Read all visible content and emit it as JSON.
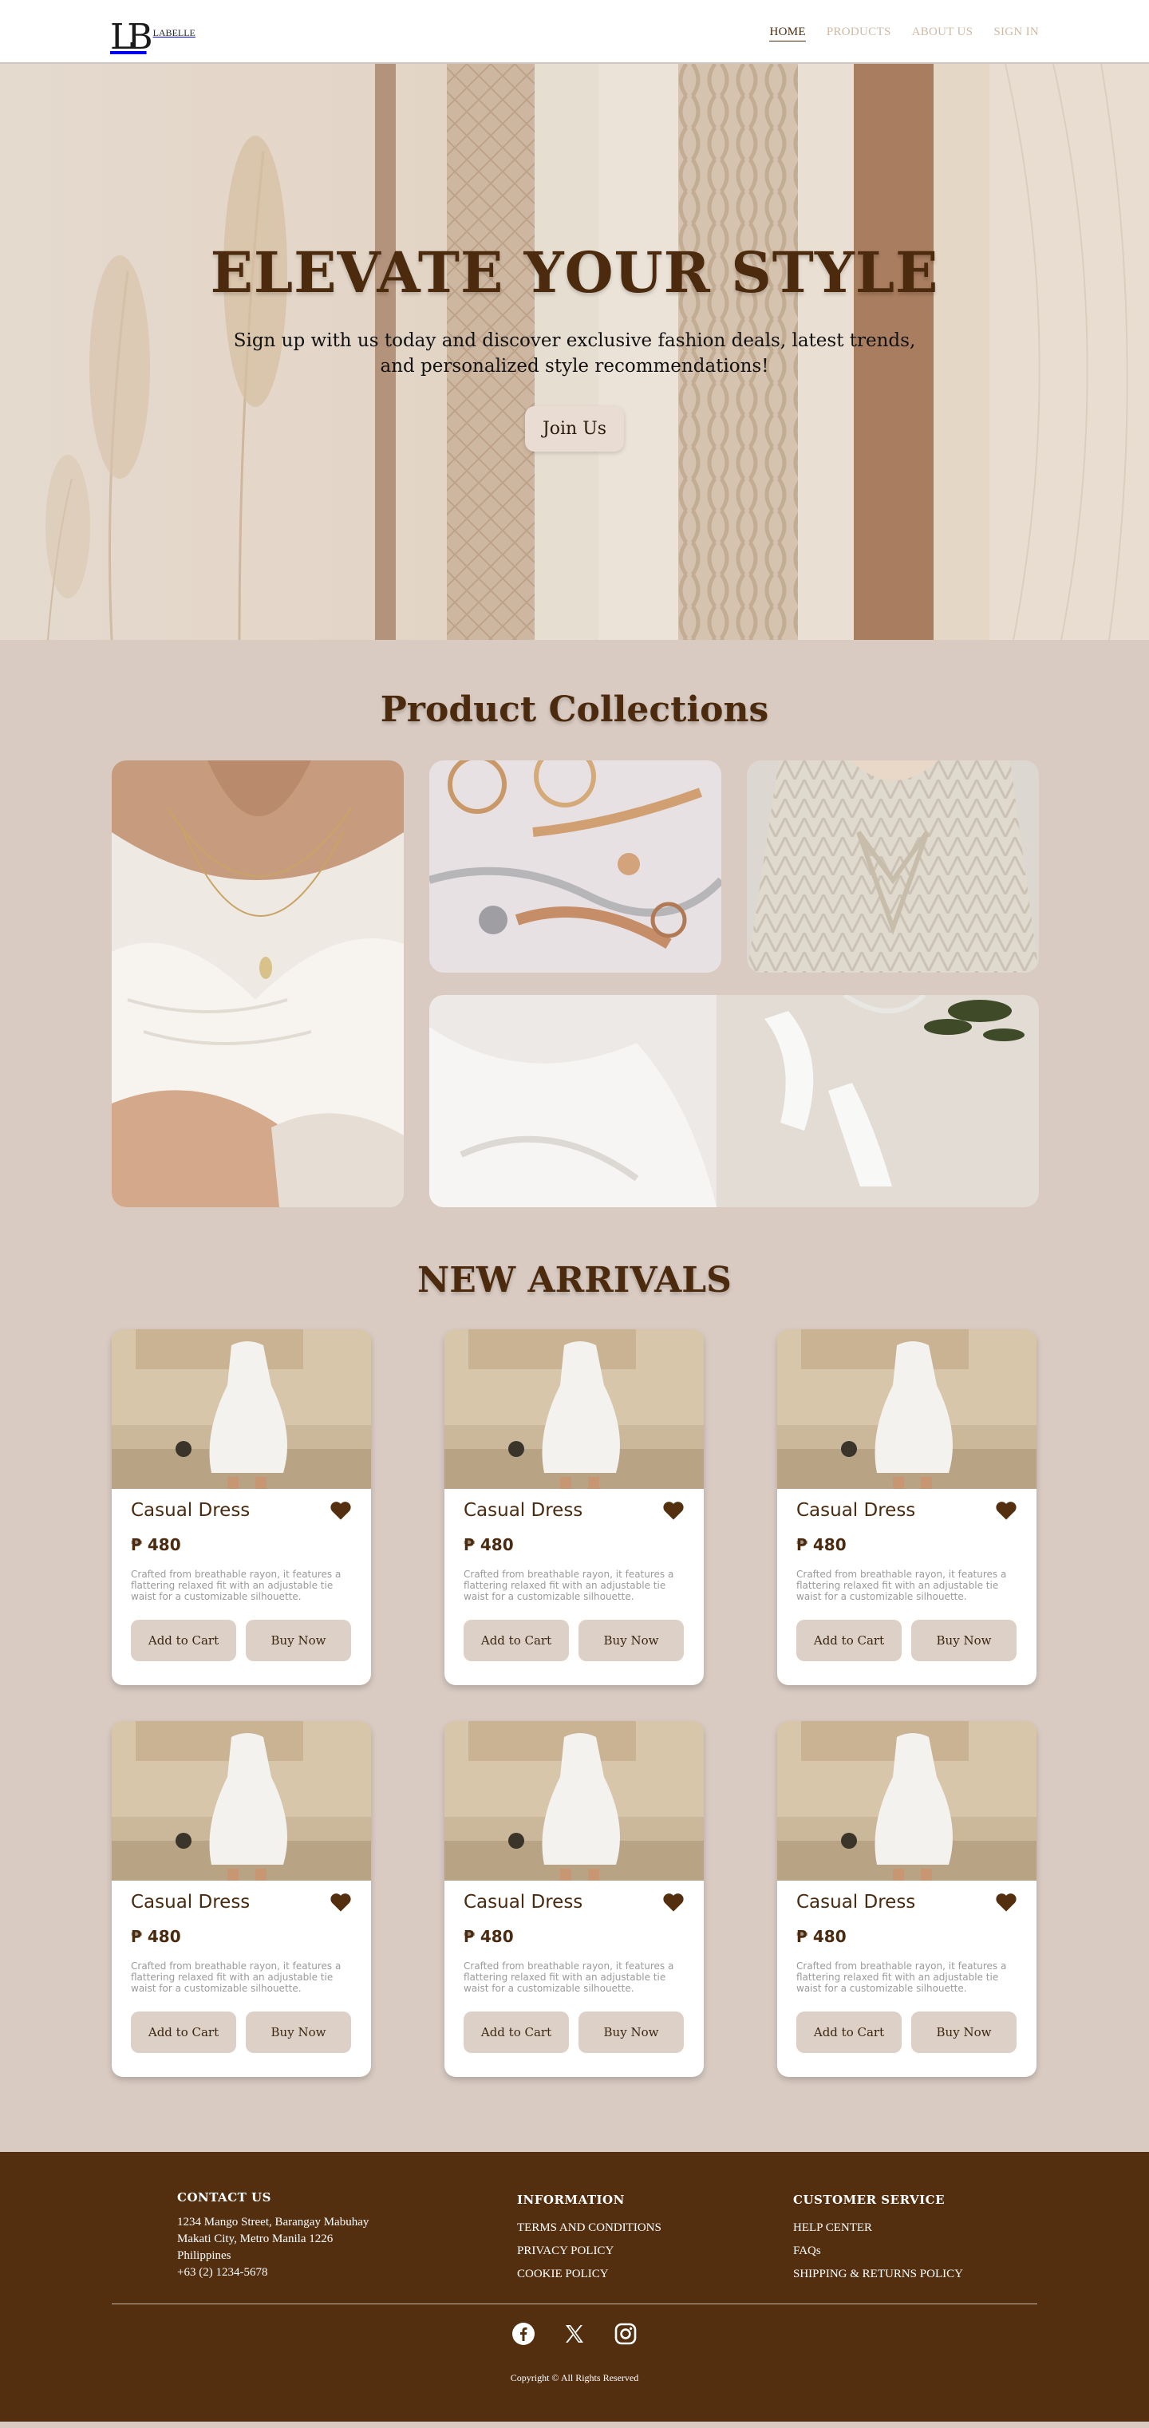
{
  "brand": {
    "mark": "LB",
    "name": "LABELLE"
  },
  "nav": {
    "items": [
      {
        "label": "HOME",
        "active": true
      },
      {
        "label": "PRODUCTS",
        "active": false
      },
      {
        "label": "ABOUT US",
        "active": false
      },
      {
        "label": "SIGN IN",
        "active": false
      }
    ]
  },
  "hero": {
    "title": "ELEVATE YOUR STYLE",
    "subtitle": "Sign up with us today and discover exclusive fashion deals, latest trends, and personalized style recommendations!",
    "cta": "Join Us"
  },
  "collections": {
    "title": "Product Collections",
    "tiles": [
      "necklace-blouse-photo",
      "jewelry-photo",
      "knit-sweater-photo",
      "white-heels-photo"
    ]
  },
  "arrivals": {
    "title": "NEW ARRIVALS",
    "products": [
      {
        "name": "Casual Dress",
        "price": "₱ 480",
        "description": "Crafted from breathable rayon, it features a flattering relaxed fit with an adjustable tie waist for a customizable silhouette.",
        "cart_label": "Add to Cart",
        "buy_label": "Buy Now"
      },
      {
        "name": "Casual Dress",
        "price": "₱ 480",
        "description": "Crafted from breathable rayon, it features a flattering relaxed fit with an adjustable tie waist for a customizable silhouette.",
        "cart_label": "Add to Cart",
        "buy_label": "Buy Now"
      },
      {
        "name": "Casual Dress",
        "price": "₱ 480",
        "description": "Crafted from breathable rayon, it features a flattering relaxed fit with an adjustable tie waist for a customizable silhouette.",
        "cart_label": "Add to Cart",
        "buy_label": "Buy Now"
      },
      {
        "name": "Casual Dress",
        "price": "₱ 480",
        "description": "Crafted from breathable rayon, it features a flattering relaxed fit with an adjustable tie waist for a customizable silhouette.",
        "cart_label": "Add to Cart",
        "buy_label": "Buy Now"
      },
      {
        "name": "Casual Dress",
        "price": "₱ 480",
        "description": "Crafted from breathable rayon, it features a flattering relaxed fit with an adjustable tie waist for a customizable silhouette.",
        "cart_label": "Add to Cart",
        "buy_label": "Buy Now"
      },
      {
        "name": "Casual Dress",
        "price": "₱ 480",
        "description": "Crafted from breathable rayon, it features a flattering relaxed fit with an adjustable tie waist for a customizable silhouette.",
        "cart_label": "Add to Cart",
        "buy_label": "Buy Now"
      }
    ]
  },
  "footer": {
    "contact": {
      "heading": "CONTACT US",
      "line1": "1234 Mango Street, Barangay Mabuhay",
      "line2": "Makati City, Metro Manila 1226",
      "line3": "Philippines",
      "phone": "+63 (2) 1234-5678"
    },
    "information": {
      "heading": "INFORMATION",
      "links": [
        "TERMS AND CONDITIONS",
        "PRIVACY POLICY",
        "COOKIE POLICY"
      ]
    },
    "service": {
      "heading": "CUSTOMER SERVICE",
      "links": [
        "HELP CENTER",
        "FAQs",
        "SHIPPING & RETURNS POLICY"
      ]
    },
    "socials": [
      "facebook-icon",
      "x-icon",
      "instagram-icon"
    ],
    "copyright": "Copyright © All Rights Reserved"
  },
  "colors": {
    "brand_brown": "#4b2a0d",
    "footer_bg": "#532f10",
    "page_bg": "#d9cbc2",
    "button_bg": "#ddd0c6"
  }
}
